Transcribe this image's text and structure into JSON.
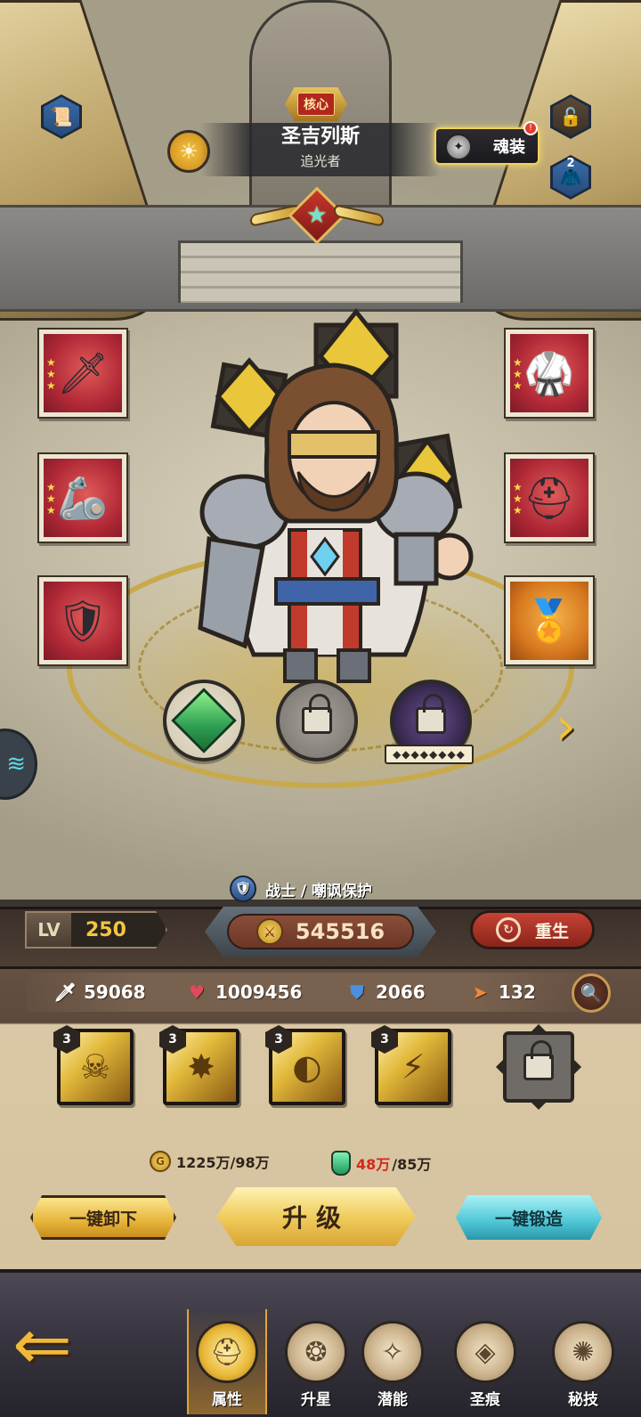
{
  "header": {
    "core_badge": "核心",
    "hero_name": "圣吉列斯",
    "hero_title": "追光者",
    "soul_gear_label": "魂装",
    "wardrobe_count": "2"
  },
  "combat": {
    "class_role": "战士 / 嘲讽保护",
    "level_label": "LV",
    "level": "250",
    "power": "545516",
    "rebirth_label": "重生"
  },
  "stats": {
    "attack": "59068",
    "hp": "1009456",
    "defense": "2066",
    "speed": "132"
  },
  "skills": [
    {
      "level": "3",
      "icon": "skull-skill-icon"
    },
    {
      "level": "3",
      "icon": "holy-burst-skill-icon"
    },
    {
      "level": "3",
      "icon": "light-wave-skill-icon"
    },
    {
      "level": "3",
      "icon": "light-beam-skill-icon"
    }
  ],
  "currency": {
    "gold": "1225万/98万",
    "potion_have": "48万",
    "potion_need": "/85万"
  },
  "actions": {
    "unequip_all": "一键卸下",
    "upgrade": "升级",
    "forge_all": "一键锻造"
  },
  "gem_sockets": {
    "star_dots": "◆◆◆◆◆◆◆◆"
  },
  "nav": [
    {
      "label": "属性",
      "icon": "helmet-icon",
      "active": true
    },
    {
      "label": "升星",
      "icon": "star-up-icon",
      "active": false
    },
    {
      "label": "潜能",
      "icon": "potential-icon",
      "active": false
    },
    {
      "label": "圣痕",
      "icon": "stigmata-icon",
      "active": false
    },
    {
      "label": "秘技",
      "icon": "secret-skill-icon",
      "active": false
    }
  ],
  "colors": {
    "gold_accent": "#f1c240",
    "level_value": "#f4c542",
    "slot_red": "#b02836",
    "slot_orange": "#d7781f",
    "potion_shortfall": "#d2281e",
    "forge_button": "#4ec6d6"
  }
}
